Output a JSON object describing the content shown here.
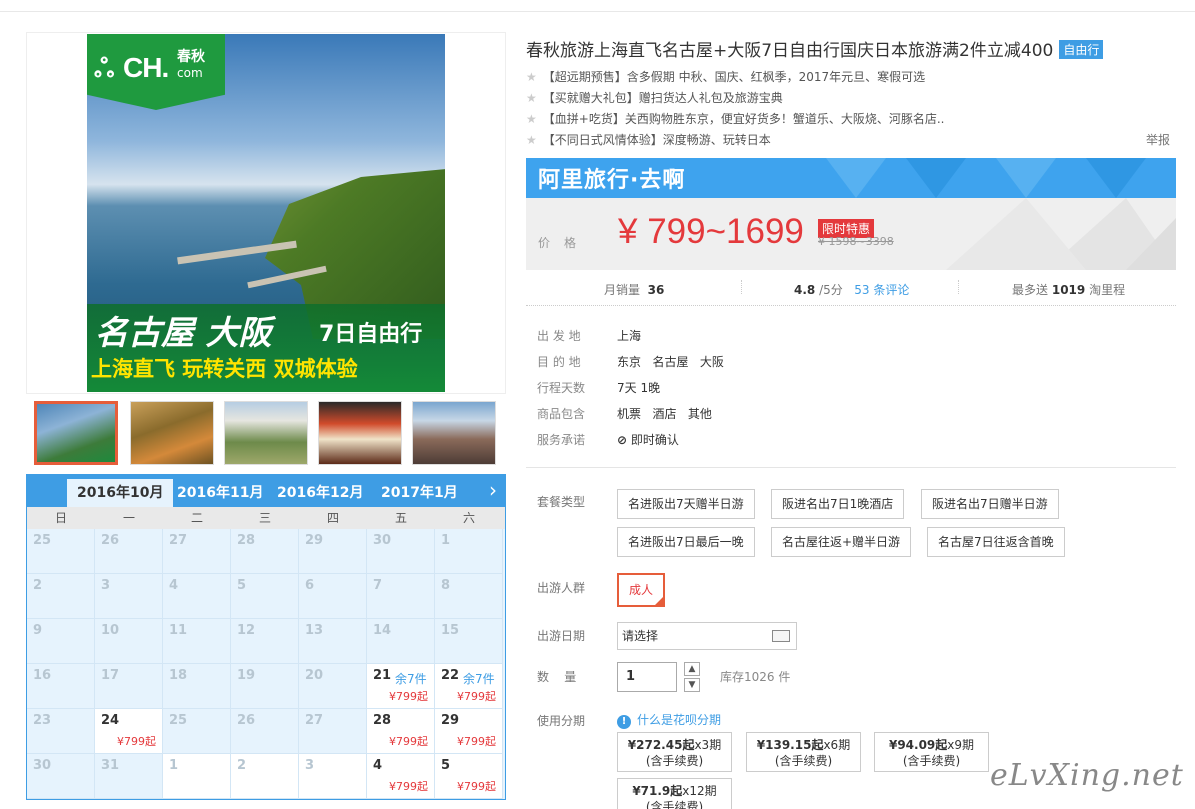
{
  "product": {
    "title": "春秋旅游上海直飞名古屋+大阪7日自由行国庆日本旅游满2件立减400",
    "badge": "自由行",
    "features": [
      "【超远期预售】含多假期 中秋、国庆、红枫季，2017年元旦、寒假可选",
      "【买就赠大礼包】赠扫货达人礼包及旅游宝典",
      "【血拼+吃货】关西购物胜东京，便宜好货多！蟹道乐、大阪烧、河豚名店..",
      "【不同日式风情体验】深度畅游、玩转日本"
    ],
    "report": "举报"
  },
  "hero": {
    "logo_mark": "ஃ",
    "logo_text": "CH.",
    "logo_cn": "春秋",
    "logo_com": "com",
    "banner_title": "名古屋 大阪",
    "banner_days": "7日自由行",
    "banner_sub": "上海直飞 玩转关西 双城体验"
  },
  "calendar": {
    "tabs": [
      "2016年10月",
      "2016年11月",
      "2016年12月",
      "2017年1月"
    ],
    "active_tab": 0,
    "next": "›",
    "weekdays": [
      "日",
      "一",
      "二",
      "三",
      "四",
      "五",
      "六"
    ],
    "rows": [
      [
        {
          "d": "25"
        },
        {
          "d": "26"
        },
        {
          "d": "27"
        },
        {
          "d": "28"
        },
        {
          "d": "29"
        },
        {
          "d": "30"
        },
        {
          "d": "1"
        }
      ],
      [
        {
          "d": "2"
        },
        {
          "d": "3"
        },
        {
          "d": "4"
        },
        {
          "d": "5"
        },
        {
          "d": "6"
        },
        {
          "d": "7"
        },
        {
          "d": "8"
        }
      ],
      [
        {
          "d": "9"
        },
        {
          "d": "10"
        },
        {
          "d": "11"
        },
        {
          "d": "12"
        },
        {
          "d": "13"
        },
        {
          "d": "14"
        },
        {
          "d": "15"
        }
      ],
      [
        {
          "d": "16"
        },
        {
          "d": "17"
        },
        {
          "d": "18"
        },
        {
          "d": "19"
        },
        {
          "d": "20"
        },
        {
          "d": "21",
          "rem": "余7件",
          "price": "¥799起"
        },
        {
          "d": "22",
          "rem": "余7件",
          "price": "¥799起"
        }
      ],
      [
        {
          "d": "23"
        },
        {
          "d": "24",
          "price": "¥799起"
        },
        {
          "d": "25"
        },
        {
          "d": "26"
        },
        {
          "d": "27"
        },
        {
          "d": "28",
          "price": "¥799起"
        },
        {
          "d": "29",
          "price": "¥799起"
        }
      ],
      [
        {
          "d": "30"
        },
        {
          "d": "31"
        },
        {
          "d": "1",
          "plain": true
        },
        {
          "d": "2",
          "plain": true
        },
        {
          "d": "3",
          "plain": true
        },
        {
          "d": "4",
          "price": "¥799起"
        },
        {
          "d": "5",
          "price": "¥799起"
        }
      ]
    ]
  },
  "price": {
    "brand": "阿里旅行·去啊",
    "label": "价格",
    "range": "¥ 799~1699",
    "promo": "限时特惠",
    "original": "¥ 1598~3398"
  },
  "stats": {
    "sales_label": "月销量",
    "sales_value": "36",
    "rating": "4.8",
    "rating_suffix": "/5分",
    "reviews": "53 条评论",
    "points_label": "最多送",
    "points_value": "1019",
    "points_suffix": "淘里程"
  },
  "info": [
    {
      "label": "出 发 地",
      "value": "上海"
    },
    {
      "label": "目 的 地",
      "value": "东京   名古屋   大阪"
    },
    {
      "label": "行程天数",
      "value": "7天 1晚"
    },
    {
      "label": "商品包含",
      "value": "机票   酒店   其他"
    },
    {
      "label": "服务承诺",
      "value": "即时确认"
    }
  ],
  "options": {
    "package_label": "套餐类型",
    "packages": [
      "名进阪出7天赠半日游",
      "阪进名出7日1晚酒店",
      "阪进名出7日赠半日游",
      "名进阪出7日最后一晚",
      "名古屋往返+赠半日游",
      "名古屋7日往返含首晚"
    ],
    "crowd_label": "出游人群",
    "crowd_value": "成人",
    "date_label": "出游日期",
    "date_placeholder": "请选择",
    "qty_label": "数    量",
    "qty_value": "1",
    "stock": "库存1026 件",
    "installment_label": "使用分期",
    "huabei_link": "什么是花呗分期",
    "installments": [
      {
        "amount": "¥272.45起",
        "term": "x3期",
        "fee": "(含手续费)"
      },
      {
        "amount": "¥139.15起",
        "term": "x6期",
        "fee": "(含手续费)"
      },
      {
        "amount": "¥94.09起",
        "term": "x9期",
        "fee": "(含手续费)"
      },
      {
        "amount": "¥71.9起",
        "term": "x12期",
        "fee": "(含手续费)"
      }
    ]
  },
  "watermark": "eLvXing.net"
}
